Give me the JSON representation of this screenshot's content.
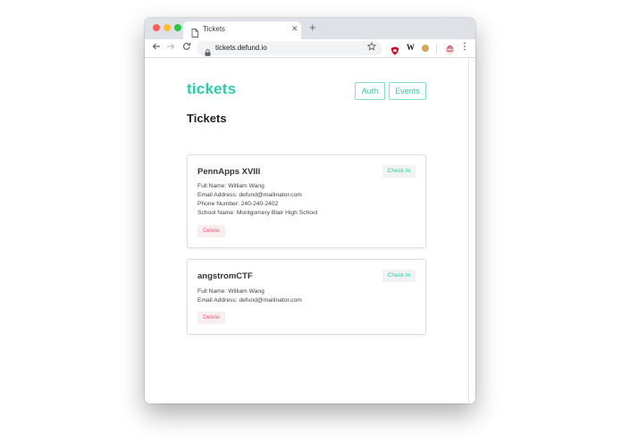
{
  "browser": {
    "tab_title": "Tickets",
    "new_tab_glyph": "+",
    "close_glyph": "✕",
    "url": "tickets.defund.io",
    "extensions": {
      "w_label": "W"
    },
    "icons": [
      "back-icon",
      "forward-icon",
      "reload-icon",
      "lock-icon",
      "star-icon",
      "shield-icon",
      "wikipedia-icon",
      "cookie-icon",
      "profile-icon",
      "menu-icon"
    ]
  },
  "site": {
    "logo": "tickets",
    "nav": {
      "auth": "Auth",
      "events": "Events"
    }
  },
  "page": {
    "title": "Tickets"
  },
  "tickets": [
    {
      "event": "PennApps XVIII",
      "checkin_label": "Check In",
      "details": [
        "Full Name: William Wang",
        "Email Address: defund@mailinator.com",
        "Phone Number: 240-240-2402",
        "School Name: Montgomery Blair High School"
      ],
      "delete_label": "Delete"
    },
    {
      "event": "angstromCTF",
      "checkin_label": "Check In",
      "details": [
        "Full Name: William Wang",
        "Email Address: defund@mailinator.com"
      ],
      "delete_label": "Delete"
    }
  ],
  "colors": {
    "accent": "#2dcca7",
    "danger": "#e8607a",
    "traffic_red": "#fe5f57",
    "traffic_yellow": "#febc2e",
    "traffic_green": "#28c840"
  }
}
